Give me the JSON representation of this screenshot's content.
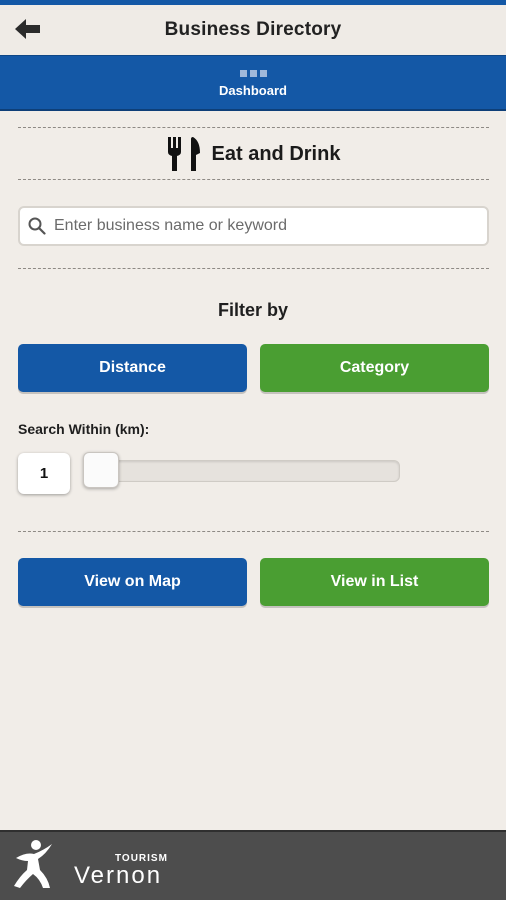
{
  "header": {
    "title": "Business Directory",
    "back_icon": "back-arrow-icon"
  },
  "dashboard": {
    "label": "Dashboard",
    "icon": "grid-icon"
  },
  "section": {
    "title": "Eat and Drink",
    "icon": "fork-knife-icon"
  },
  "search": {
    "placeholder": "Enter business name or keyword",
    "value": "",
    "icon": "search-icon"
  },
  "filter": {
    "label": "Filter by",
    "distance_label": "Distance",
    "category_label": "Category"
  },
  "search_within": {
    "label": "Search Within (km):",
    "value": "1"
  },
  "actions": {
    "map_label": "View on Map",
    "list_label": "View in List"
  },
  "footer": {
    "small": "TOURISM",
    "big": "Vernon"
  },
  "colors": {
    "blue": "#1458a6",
    "green": "#4a9e32",
    "background": "#f1ede8",
    "footer": "#4d4d4d"
  }
}
